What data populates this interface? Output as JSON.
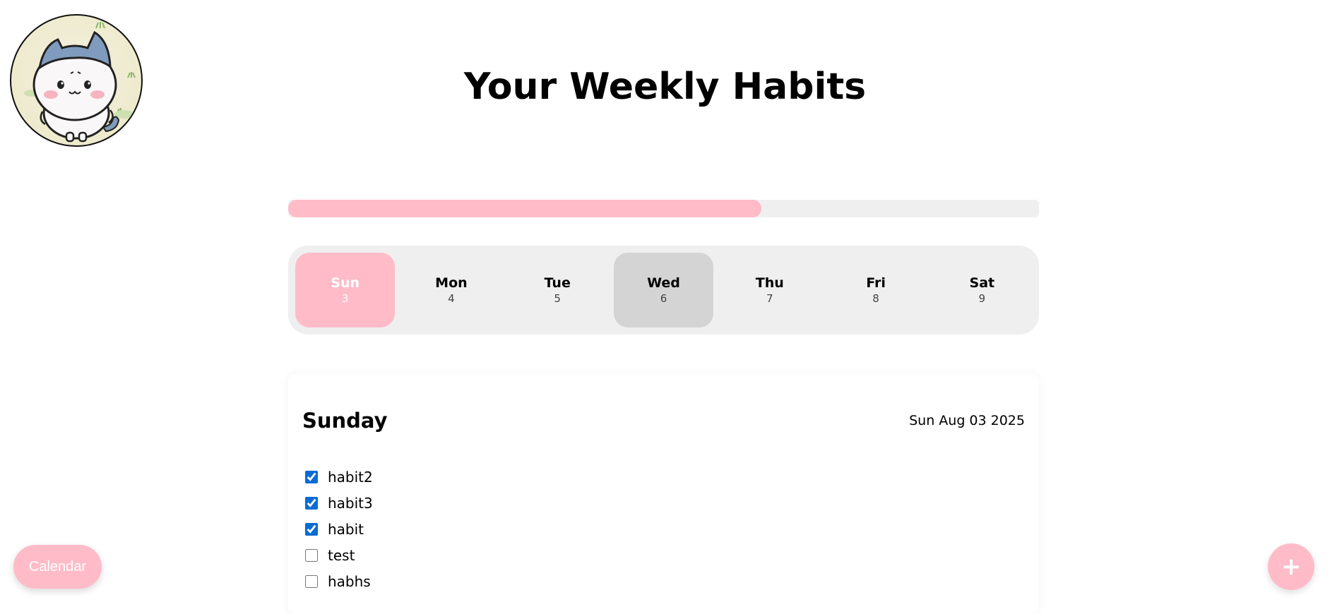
{
  "header": {
    "title": "Your Weekly Habits",
    "avatar_icon": "cat-avatar-icon"
  },
  "progress": {
    "fraction": 0.63,
    "color": "#ffbcc8"
  },
  "week": {
    "days": [
      {
        "name": "Sun",
        "num": "3",
        "state": "selected"
      },
      {
        "name": "Mon",
        "num": "4",
        "state": ""
      },
      {
        "name": "Tue",
        "num": "5",
        "state": ""
      },
      {
        "name": "Wed",
        "num": "6",
        "state": "today"
      },
      {
        "name": "Thu",
        "num": "7",
        "state": ""
      },
      {
        "name": "Fri",
        "num": "8",
        "state": ""
      },
      {
        "name": "Sat",
        "num": "9",
        "state": ""
      }
    ]
  },
  "day_card": {
    "title": "Sunday",
    "date": "Sun Aug 03 2025",
    "habits": [
      {
        "label": "habit2",
        "checked": true
      },
      {
        "label": "habit3",
        "checked": true
      },
      {
        "label": "habit",
        "checked": true
      },
      {
        "label": "test",
        "checked": false
      },
      {
        "label": "habhs",
        "checked": false
      }
    ]
  },
  "buttons": {
    "calendar_label": "Calendar",
    "add_label": "+"
  },
  "colors": {
    "accent": "#ffbcc8",
    "today": "#d4d4d4",
    "track": "#efefef",
    "checkbox": "#0b6bd3"
  }
}
